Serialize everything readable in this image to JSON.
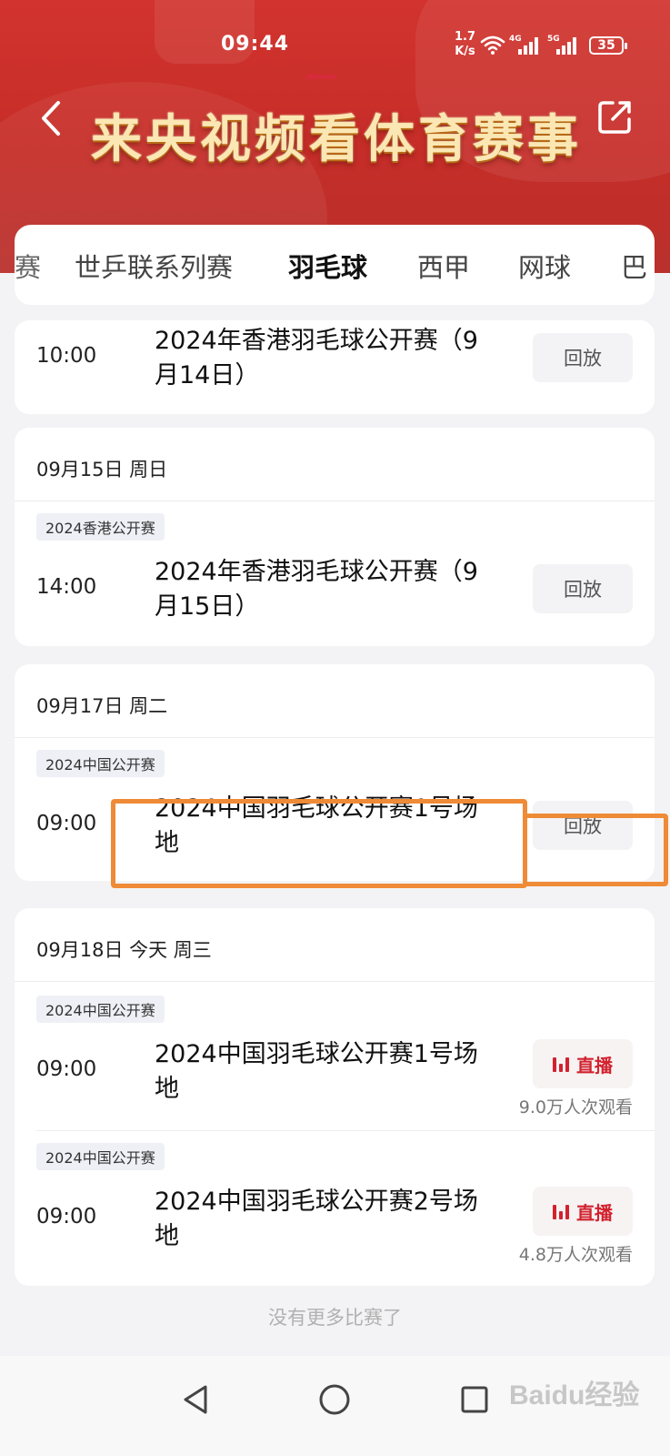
{
  "status_bar": {
    "time": "09:44",
    "net_speed_value": "1.7",
    "net_speed_unit": "K/s",
    "signal1_label": "4G",
    "signal2_label": "5G",
    "battery": "35"
  },
  "header": {
    "banner_title": "来央视频看体育赛事",
    "colors": {
      "background": "#c62d28",
      "title": "#fbe7b3"
    }
  },
  "tabs": [
    {
      "label": "赛",
      "active": false
    },
    {
      "label": "世乒联系列赛",
      "active": false
    },
    {
      "label": "羽毛球",
      "active": true
    },
    {
      "label": "西甲",
      "active": false
    },
    {
      "label": "网球",
      "active": false
    },
    {
      "label": "巴",
      "active": false
    }
  ],
  "groups": [
    {
      "date": "",
      "matches": [
        {
          "tag": "",
          "time": "10:00",
          "title": "2024年香港羽毛球公开赛（9月14日）",
          "action": "回放"
        }
      ]
    },
    {
      "date": "09月15日 周日",
      "matches": [
        {
          "tag": "2024香港公开赛",
          "time": "14:00",
          "title": "2024年香港羽毛球公开赛（9月15日）",
          "action": "回放"
        }
      ]
    },
    {
      "date": "09月17日 周二",
      "matches": [
        {
          "tag": "2024中国公开赛",
          "time": "09:00",
          "title": "2024中国羽毛球公开赛1号场地",
          "action": "回放"
        }
      ]
    },
    {
      "date": "09月18日 今天 周三",
      "matches": [
        {
          "tag": "2024中国公开赛",
          "time": "09:00",
          "title": "2024中国羽毛球公开赛1号场地",
          "action": "直播",
          "viewers": "9.0万人次观看"
        },
        {
          "tag": "2024中国公开赛",
          "time": "09:00",
          "title": "2024中国羽毛球公开赛2号场地",
          "action": "直播",
          "viewers": "4.8万人次观看"
        }
      ]
    }
  ],
  "footer_text": "没有更多比赛了",
  "watermark": "Baidu经验",
  "accent_colors": {
    "tab_indicator": "#d62b3a",
    "live": "#d2222e",
    "highlight": "#ef8a36"
  }
}
